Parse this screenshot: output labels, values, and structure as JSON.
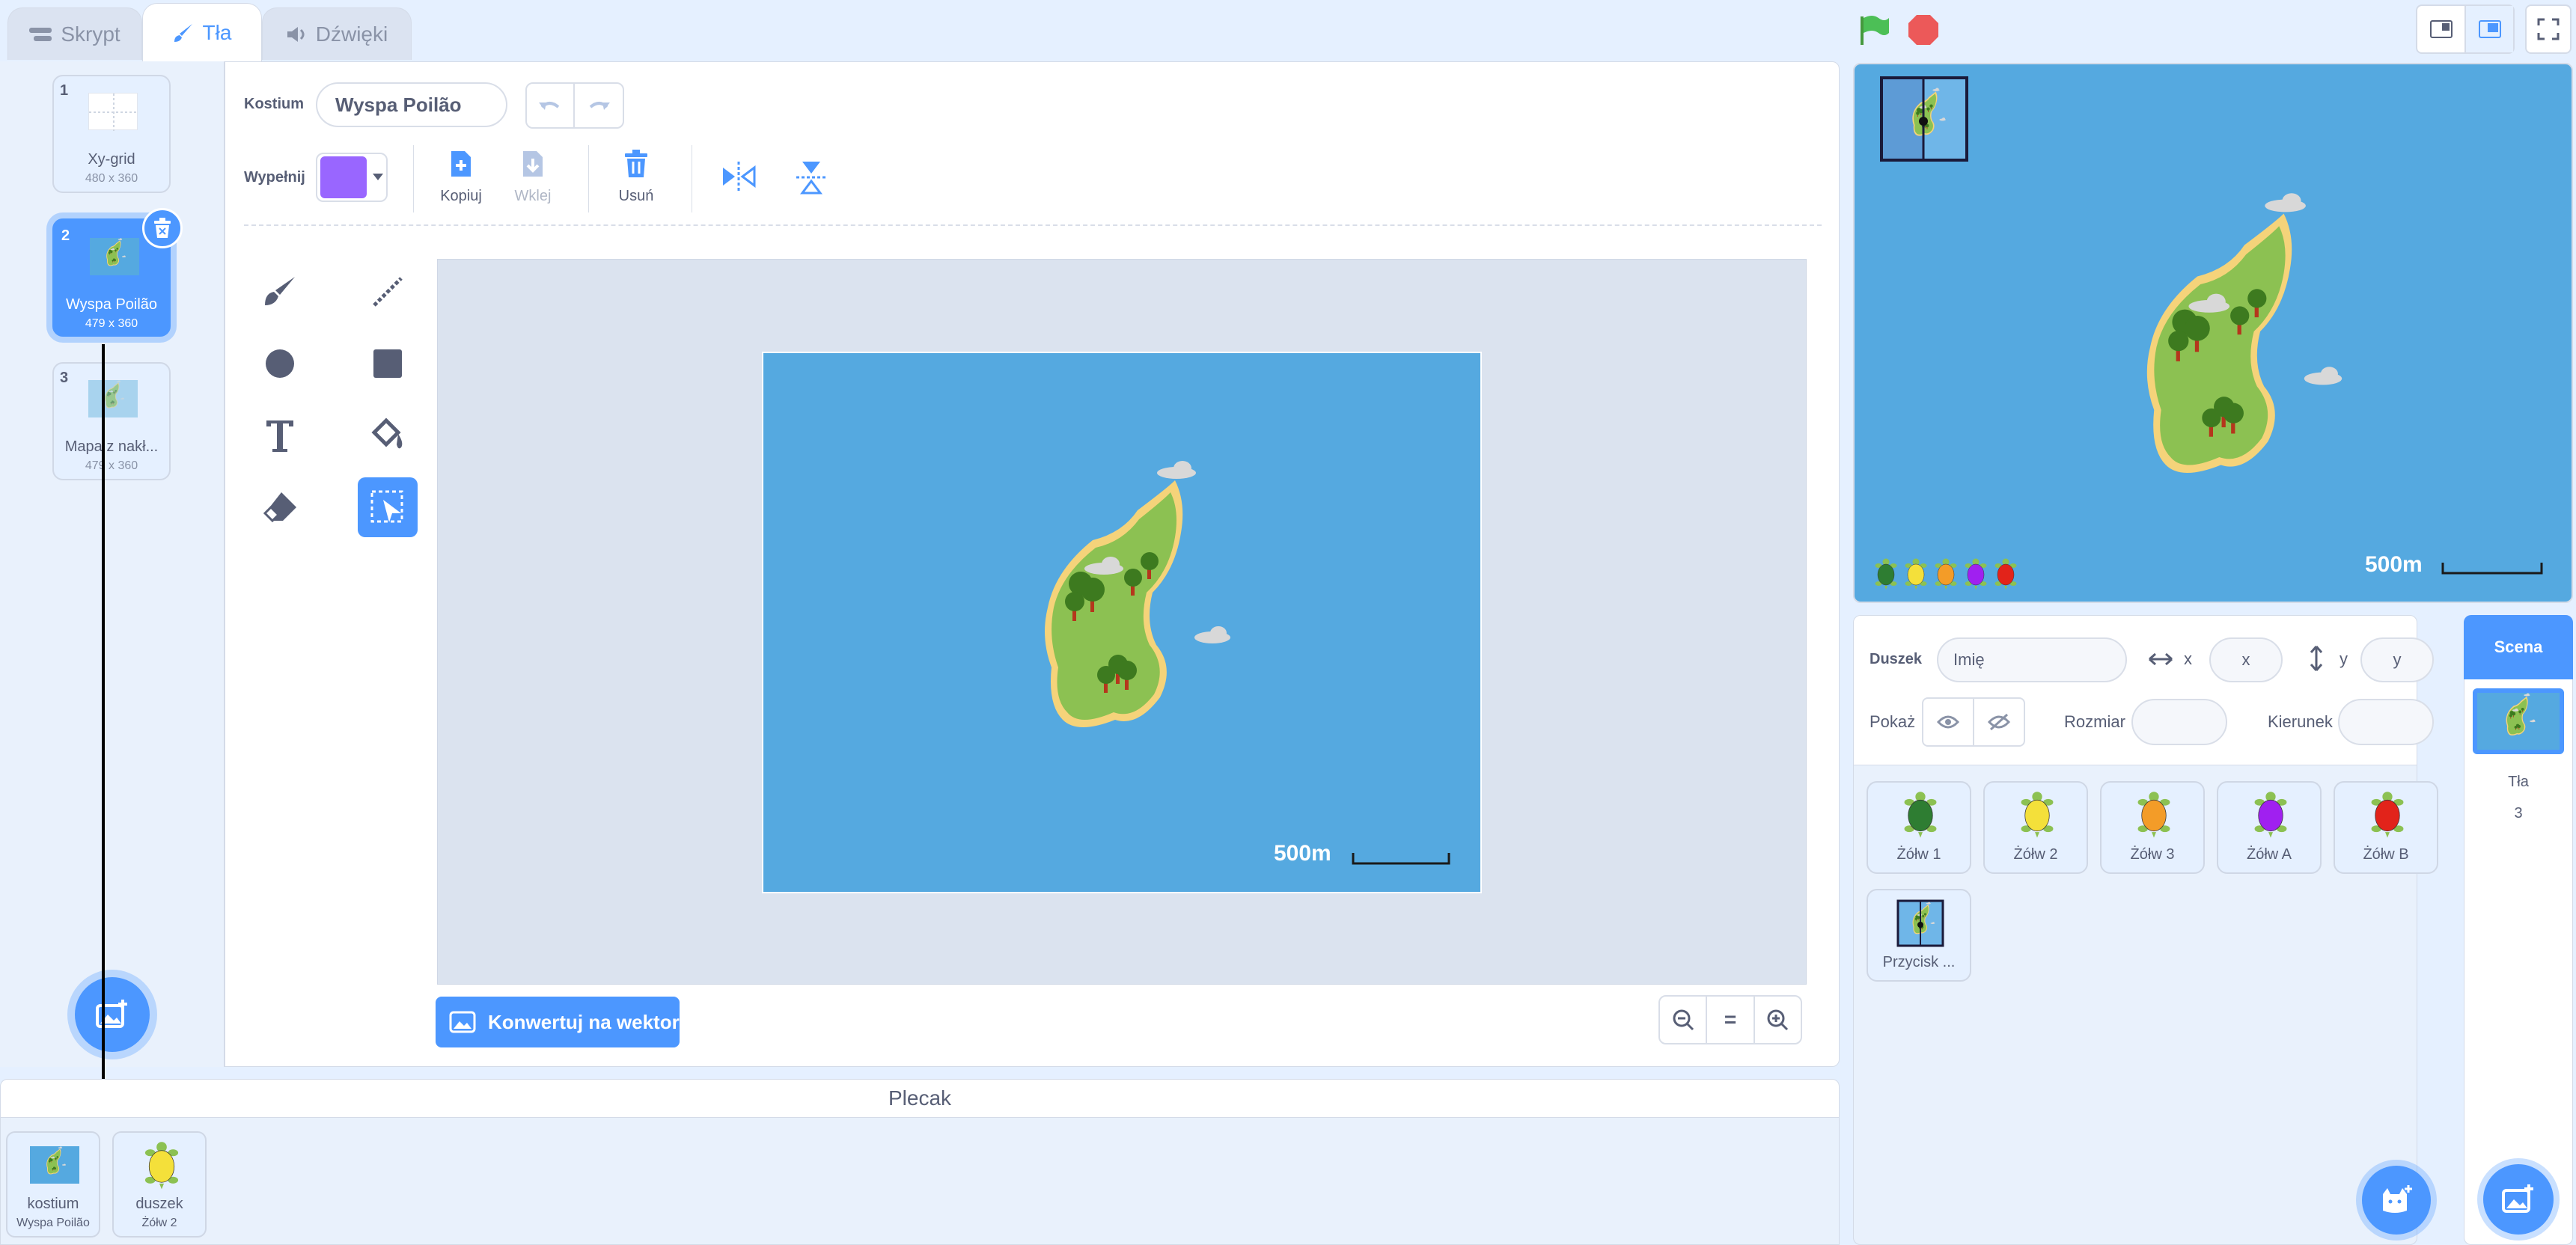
{
  "tabs": [
    {
      "label": "Skrypt"
    },
    {
      "label": "Tła"
    },
    {
      "label": "Dźwięki"
    }
  ],
  "costumes": [
    {
      "num": "1",
      "name": "Xy-grid",
      "size": "480 x 360"
    },
    {
      "num": "2",
      "name": "Wyspa Poilão",
      "size": "479 x 360"
    },
    {
      "num": "3",
      "name": "Mapa z nakł...",
      "size": "479 x 360"
    }
  ],
  "editor": {
    "costume_label": "Kostium",
    "costume_name": "Wyspa Poilão",
    "fill_label": "Wypełnij",
    "fill_color": "#9966ff",
    "copy": "Kopiuj",
    "paste": "Wklej",
    "delete": "Usuń",
    "convert": "Konwertuj na wektor",
    "zoom_reset": "="
  },
  "canvas": {
    "scale": "500m"
  },
  "stage": {
    "scale": "500m"
  },
  "sprite_info": {
    "sprite_label": "Duszek",
    "name_placeholder": "Imię",
    "x_label": "x",
    "x_placeholder": "x",
    "y_label": "y",
    "y_placeholder": "y",
    "show_label": "Pokaż",
    "size_label": "Rozmiar",
    "direction_label": "Kierunek"
  },
  "sprites": [
    {
      "name": "Żółw 1",
      "color": "#2e7d32"
    },
    {
      "name": "Żółw 2",
      "color": "#f4e03a"
    },
    {
      "name": "Żółw 3",
      "color": "#f39c28"
    },
    {
      "name": "Żółw A",
      "color": "#a020f0"
    },
    {
      "name": "Żółw B",
      "color": "#e2231a"
    },
    {
      "name": "Przycisk ...",
      "color": ""
    }
  ],
  "scene": {
    "title": "Scena",
    "backdrops_label": "Tła",
    "backdrops_count": "3"
  },
  "backpack": {
    "title": "Plecak",
    "items": [
      {
        "type": "kostium",
        "name": "Wyspa Poilão"
      },
      {
        "type": "duszek",
        "name": "Żółw 2"
      }
    ]
  },
  "colors": {
    "accent": "#4c97ff",
    "sea": "#55a9e0",
    "island": "#8cc152",
    "sand": "#f5d37a",
    "tree": "#3d7a1f",
    "green_flag": "#4cbf56",
    "stop": "#ec5959"
  }
}
